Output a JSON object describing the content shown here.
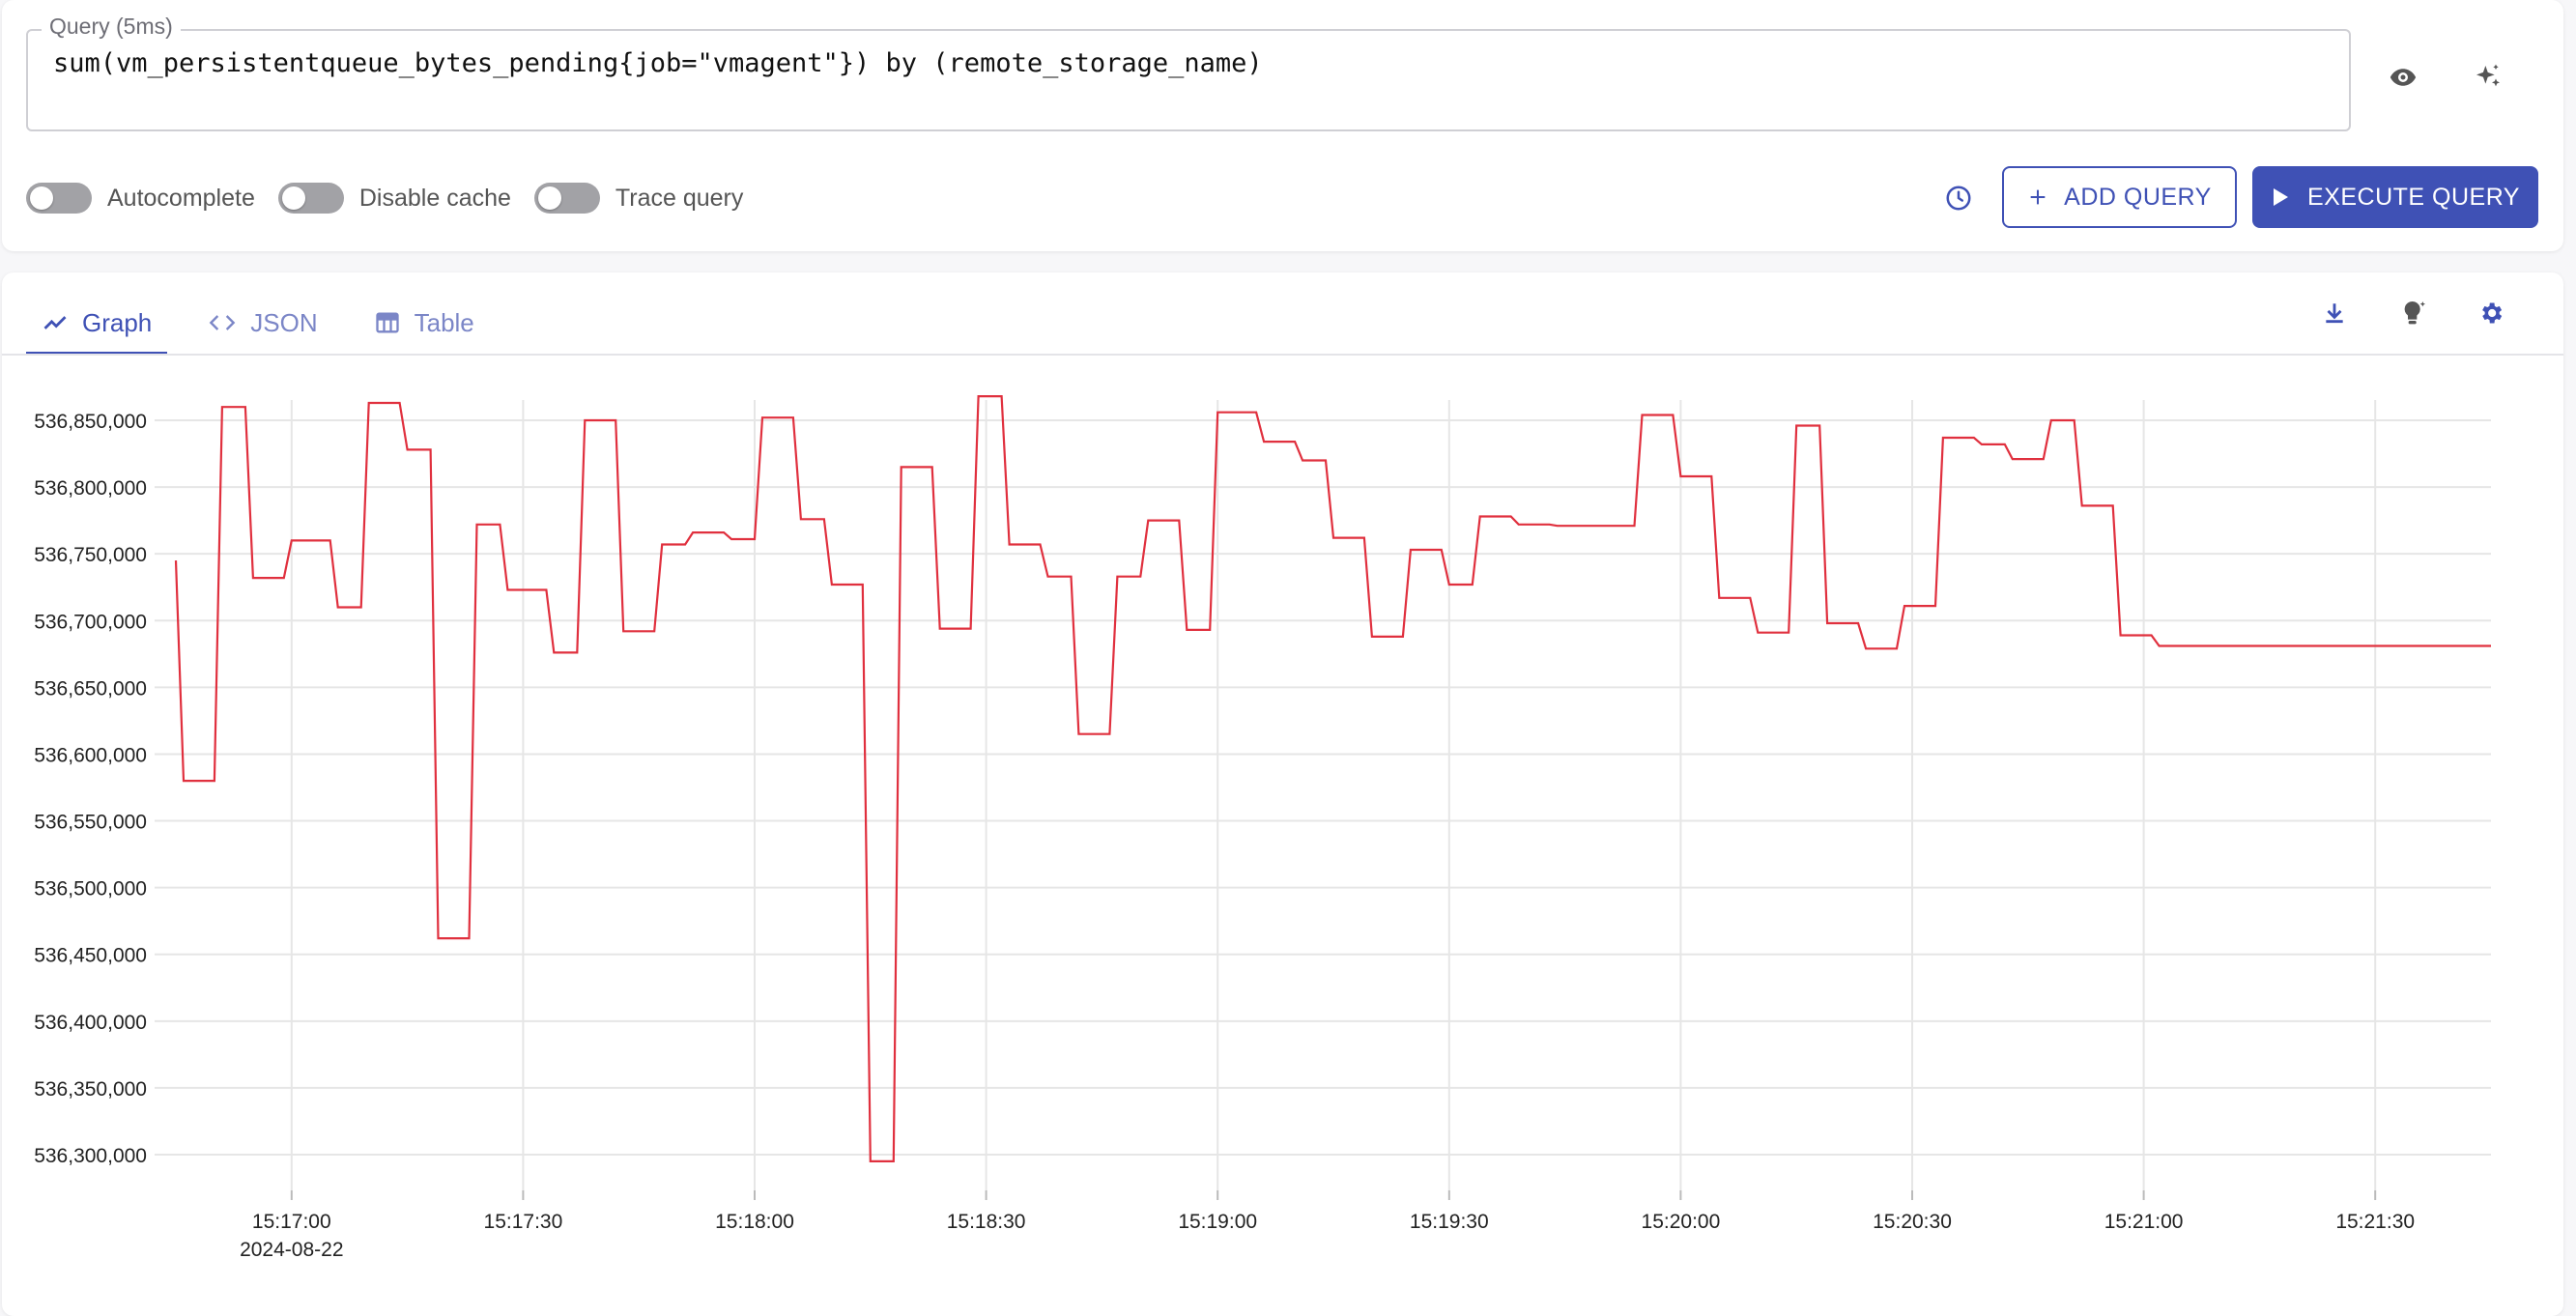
{
  "query": {
    "legend": "Query (5ms)",
    "expression": "sum(vm_persistentqueue_bytes_pending{job=\"vmagent\"}) by (remote_storage_name)"
  },
  "options": {
    "autocomplete": "Autocomplete",
    "disable_cache": "Disable cache",
    "trace_query": "Trace query"
  },
  "buttons": {
    "add_query": "ADD QUERY",
    "execute_query": "EXECUTE QUERY"
  },
  "tabs": [
    {
      "label": "Graph",
      "icon": "line-chart-icon",
      "active": true
    },
    {
      "label": "JSON",
      "icon": "code-icon",
      "active": false
    },
    {
      "label": "Table",
      "icon": "table-icon",
      "active": false
    }
  ],
  "toolbar_icons": [
    "download-icon",
    "lightbulb-icon",
    "gear-icon"
  ],
  "colors": {
    "accent": "#3f51b5",
    "series": "#e0303e"
  },
  "chart_data": {
    "type": "line",
    "title": "",
    "xlabel": "",
    "ylabel": "",
    "date_label": "2024-08-22",
    "x_ticks": [
      "15:17:00",
      "15:17:30",
      "15:18:00",
      "15:18:30",
      "15:19:00",
      "15:19:30",
      "15:20:00",
      "15:20:30",
      "15:21:00",
      "15:21:30"
    ],
    "y_ticks": [
      "536,300,000",
      "536,350,000",
      "536,400,000",
      "536,450,000",
      "536,500,000",
      "536,550,000",
      "536,600,000",
      "536,650,000",
      "536,700,000",
      "536,750,000",
      "536,800,000",
      "536,850,000"
    ],
    "xlim": [
      "15:16:45",
      "15:21:45"
    ],
    "ylim": [
      536300000,
      536850000
    ],
    "grid": true,
    "series": [
      {
        "color": "#e0303e",
        "points": [
          [
            "15:16:45",
            536745000
          ],
          [
            "15:16:46",
            536580000
          ],
          [
            "15:16:50",
            536580000
          ],
          [
            "15:16:51",
            536860000
          ],
          [
            "15:16:54",
            536860000
          ],
          [
            "15:16:55",
            536732000
          ],
          [
            "15:16:59",
            536732000
          ],
          [
            "15:17:00",
            536760000
          ],
          [
            "15:17:05",
            536760000
          ],
          [
            "15:17:06",
            536710000
          ],
          [
            "15:17:09",
            536710000
          ],
          [
            "15:17:10",
            536863000
          ],
          [
            "15:17:14",
            536863000
          ],
          [
            "15:17:15",
            536828000
          ],
          [
            "15:17:18",
            536828000
          ],
          [
            "15:17:19",
            536462000
          ],
          [
            "15:17:23",
            536462000
          ],
          [
            "15:17:24",
            536772000
          ],
          [
            "15:17:27",
            536772000
          ],
          [
            "15:17:28",
            536723000
          ],
          [
            "15:17:33",
            536723000
          ],
          [
            "15:17:34",
            536676000
          ],
          [
            "15:17:37",
            536676000
          ],
          [
            "15:17:38",
            536850000
          ],
          [
            "15:17:42",
            536850000
          ],
          [
            "15:17:43",
            536692000
          ],
          [
            "15:17:47",
            536692000
          ],
          [
            "15:17:48",
            536757000
          ],
          [
            "15:17:51",
            536757000
          ],
          [
            "15:17:52",
            536766000
          ],
          [
            "15:17:56",
            536766000
          ],
          [
            "15:17:57",
            536761000
          ],
          [
            "15:18:00",
            536761000
          ],
          [
            "15:18:01",
            536852000
          ],
          [
            "15:18:05",
            536852000
          ],
          [
            "15:18:06",
            536776000
          ],
          [
            "15:18:09",
            536776000
          ],
          [
            "15:18:10",
            536727000
          ],
          [
            "15:18:14",
            536727000
          ],
          [
            "15:18:15",
            536295000
          ],
          [
            "15:18:18",
            536295000
          ],
          [
            "15:18:19",
            536815000
          ],
          [
            "15:18:23",
            536815000
          ],
          [
            "15:18:24",
            536694000
          ],
          [
            "15:18:28",
            536694000
          ],
          [
            "15:18:29",
            536868000
          ],
          [
            "15:18:32",
            536868000
          ],
          [
            "15:18:33",
            536757000
          ],
          [
            "15:18:37",
            536757000
          ],
          [
            "15:18:38",
            536733000
          ],
          [
            "15:18:41",
            536733000
          ],
          [
            "15:18:42",
            536615000
          ],
          [
            "15:18:46",
            536615000
          ],
          [
            "15:18:47",
            536733000
          ],
          [
            "15:18:50",
            536733000
          ],
          [
            "15:18:51",
            536775000
          ],
          [
            "15:18:55",
            536775000
          ],
          [
            "15:18:56",
            536693000
          ],
          [
            "15:18:59",
            536693000
          ],
          [
            "15:19:00",
            536856000
          ],
          [
            "15:19:05",
            536856000
          ],
          [
            "15:19:06",
            536834000
          ],
          [
            "15:19:10",
            536834000
          ],
          [
            "15:19:11",
            536820000
          ],
          [
            "15:19:14",
            536820000
          ],
          [
            "15:19:15",
            536762000
          ],
          [
            "15:19:19",
            536762000
          ],
          [
            "15:19:20",
            536688000
          ],
          [
            "15:19:24",
            536688000
          ],
          [
            "15:19:25",
            536753000
          ],
          [
            "15:19:29",
            536753000
          ],
          [
            "15:19:30",
            536727000
          ],
          [
            "15:19:33",
            536727000
          ],
          [
            "15:19:34",
            536778000
          ],
          [
            "15:19:38",
            536778000
          ],
          [
            "15:19:39",
            536772000
          ],
          [
            "15:19:43",
            536772000
          ],
          [
            "15:19:44",
            536771000
          ],
          [
            "15:19:54",
            536771000
          ],
          [
            "15:19:55",
            536854000
          ],
          [
            "15:19:59",
            536854000
          ],
          [
            "15:20:00",
            536808000
          ],
          [
            "15:20:04",
            536808000
          ],
          [
            "15:20:05",
            536717000
          ],
          [
            "15:20:09",
            536717000
          ],
          [
            "15:20:10",
            536691000
          ],
          [
            "15:20:14",
            536691000
          ],
          [
            "15:20:15",
            536846000
          ],
          [
            "15:20:18",
            536846000
          ],
          [
            "15:20:19",
            536698000
          ],
          [
            "15:20:23",
            536698000
          ],
          [
            "15:20:24",
            536679000
          ],
          [
            "15:20:28",
            536679000
          ],
          [
            "15:20:29",
            536711000
          ],
          [
            "15:20:33",
            536711000
          ],
          [
            "15:20:34",
            536837000
          ],
          [
            "15:20:38",
            536837000
          ],
          [
            "15:20:39",
            536832000
          ],
          [
            "15:20:42",
            536832000
          ],
          [
            "15:20:43",
            536821000
          ],
          [
            "15:20:47",
            536821000
          ],
          [
            "15:20:48",
            536850000
          ],
          [
            "15:20:51",
            536850000
          ],
          [
            "15:20:52",
            536786000
          ],
          [
            "15:20:56",
            536786000
          ],
          [
            "15:20:57",
            536689000
          ],
          [
            "15:21:01",
            536689000
          ],
          [
            "15:21:02",
            536681000
          ],
          [
            "15:21:45",
            536681000
          ]
        ]
      }
    ]
  }
}
